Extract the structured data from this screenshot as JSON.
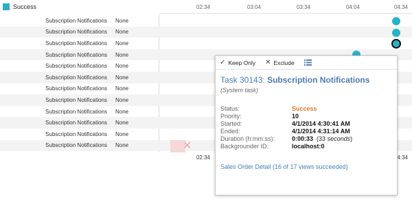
{
  "legend": {
    "label": "Success",
    "color": "#2bafbf"
  },
  "axis": {
    "top_ticks": [
      "02:34",
      "03:04",
      "03:34",
      "04:04",
      "04:34"
    ],
    "bottom_ticks": [
      "02:34",
      "04:34"
    ]
  },
  "rows": [
    {
      "task": "Subscription Notifications",
      "status": "None"
    },
    {
      "task": "Subscription Notifications",
      "status": "None"
    },
    {
      "task": "Subscription Notifications",
      "status": "None"
    },
    {
      "task": "Subscription Notifications",
      "status": "None"
    },
    {
      "task": "Subscription Notifications",
      "status": "None"
    },
    {
      "task": "Subscription Notifications",
      "status": "None"
    },
    {
      "task": "Subscription Notifications",
      "status": "None"
    },
    {
      "task": "Subscription Notifications",
      "status": "None"
    },
    {
      "task": "Subscription Notifications",
      "status": "None"
    },
    {
      "task": "Subscription Notifications",
      "status": "None"
    },
    {
      "task": "Subscription Notifications",
      "status": "None"
    },
    {
      "task": "Subscription Notifications",
      "status": "None"
    }
  ],
  "tooltip": {
    "toolbar": {
      "keep_only": "Keep Only",
      "exclude": "Exclude"
    },
    "title_prefix": "Task 30143:",
    "title_name": "Subscription Notifications",
    "subtitle": "(System task)",
    "fields": {
      "status_label": "Status:",
      "status_value": "Success",
      "priority_label": "Priority:",
      "priority_value": "10",
      "started_label": "Started:",
      "started_value": "4/1/2014 4:30:41 AM",
      "ended_label": "Ended:",
      "ended_value": "4/1/2014 4:31:14 AM",
      "duration_label": "Duration (h:mm:ss):",
      "duration_value": "0:00:33",
      "duration_paren_open": "(33",
      "duration_seconds": "seconds",
      "duration_paren_close": ")",
      "backgrounder_label": "Backgrounder ID:",
      "backgrounder_value": "localhost:0"
    },
    "link": "Sales Order Detail (16 of 17 views succeeded)"
  }
}
